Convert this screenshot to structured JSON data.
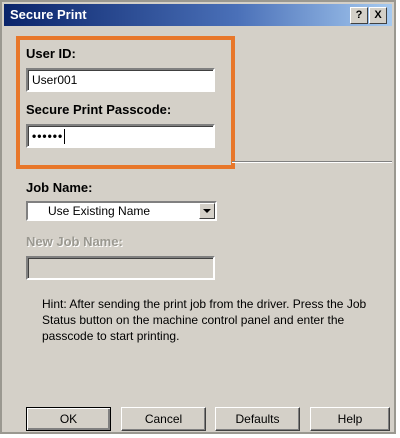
{
  "dialog": {
    "title": "Secure Print",
    "help_button": "?",
    "close_button": "X"
  },
  "user_id": {
    "label": "User ID:",
    "value": "User001"
  },
  "passcode": {
    "label": "Secure Print Passcode:",
    "value": "••••••"
  },
  "job_name": {
    "label": "Job Name:",
    "selected": "Use Existing Name"
  },
  "new_job_name": {
    "label": "New Job Name:",
    "value": ""
  },
  "hint": "Hint: After sending the print job from the driver. Press the Job Status button on the machine control panel and enter the passcode to start printing.",
  "buttons": {
    "ok": "OK",
    "cancel": "Cancel",
    "defaults": "Defaults",
    "help": "Help"
  },
  "colors": {
    "highlight": "#e8772a",
    "titlebar": "#0a246a",
    "dialog_bg": "#d4d0c8"
  }
}
